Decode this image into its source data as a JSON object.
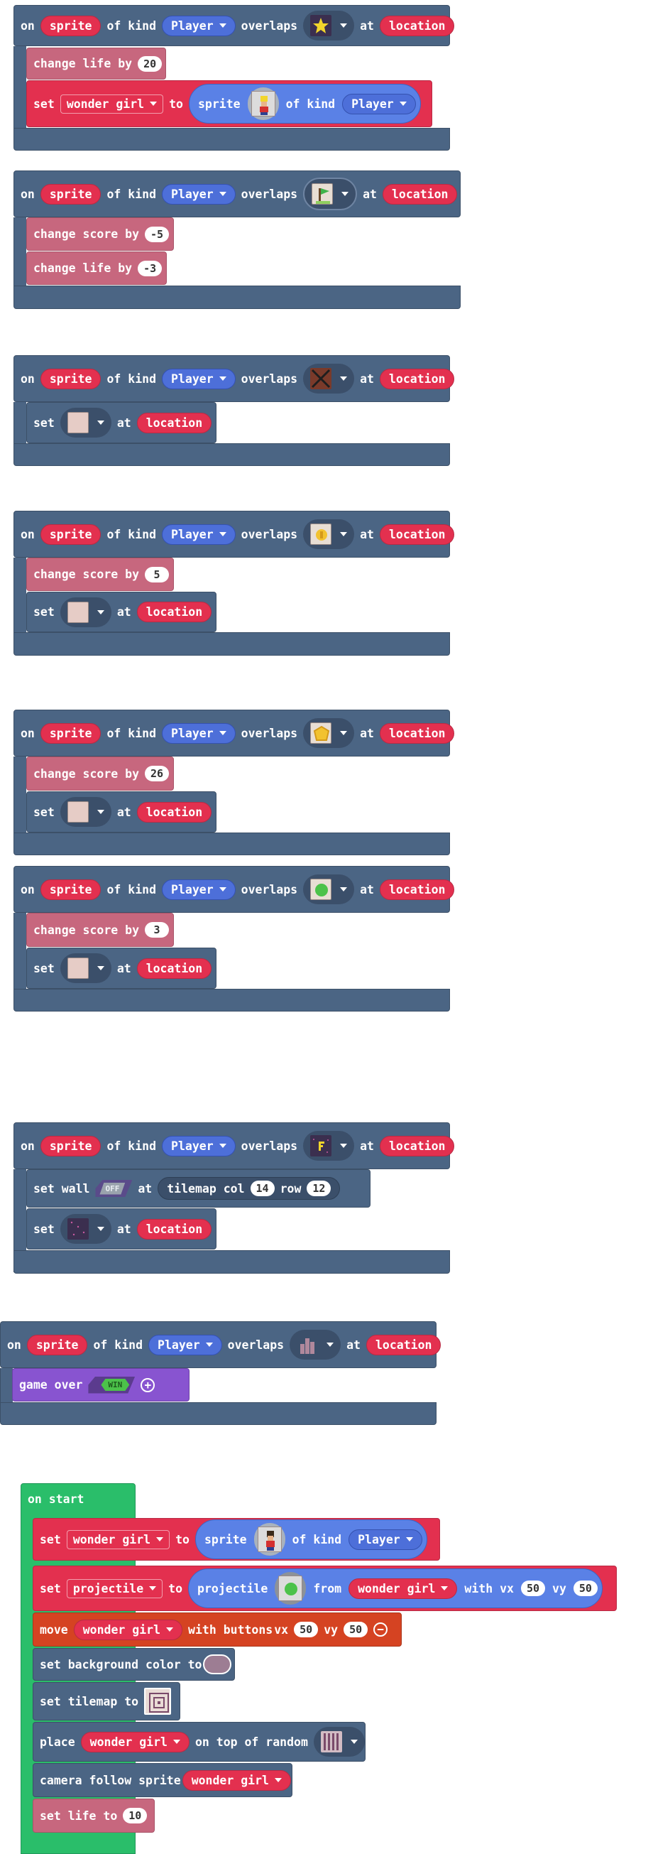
{
  "words": {
    "on": "on",
    "of_kind": "of kind",
    "overlaps": "overlaps",
    "at": "at",
    "change_life_by": "change life by",
    "change_score_by": "change score by",
    "set": "set",
    "to": "to",
    "of_kind2": "of kind",
    "set_wall": "set wall",
    "tilemap_col": "tilemap col",
    "row": "row",
    "game_over": "game over",
    "on_start": "on start",
    "from": "from",
    "with_vx": "with vx",
    "vy": "vy",
    "move": "move",
    "with_buttons": "with buttons",
    "vx": "vx",
    "set_bg_color": "set background color to",
    "set_tilemap": "set tilemap to",
    "place": "place",
    "on_top_of_random": "on top of random",
    "camera_follow": "camera follow sprite",
    "set_life_to": "set life to",
    "projectile": "projectile"
  },
  "common": {
    "sprite": "sprite",
    "kind": "Player",
    "location": "location"
  },
  "events": [
    {
      "image_icon": "yellow-star-icon",
      "statements": [
        {
          "type": "change life",
          "value": "20"
        },
        {
          "type": "set variable",
          "variable": "wonder girl",
          "sprite_kind": "Player"
        }
      ]
    },
    {
      "image_icon": "flag-icon",
      "statements": [
        {
          "type": "change score",
          "value": "-5"
        },
        {
          "type": "change life",
          "value": "-3"
        }
      ]
    },
    {
      "image_icon": "crossed-box-icon",
      "statements": [
        {
          "type": "set tile"
        }
      ]
    },
    {
      "image_icon": "coin-icon",
      "statements": [
        {
          "type": "change score",
          "value": "5"
        },
        {
          "type": "set tile"
        }
      ]
    },
    {
      "image_icon": "gem-icon",
      "statements": [
        {
          "type": "change score",
          "value": "26"
        },
        {
          "type": "set tile"
        }
      ]
    },
    {
      "image_icon": "green-blob-icon",
      "statements": [
        {
          "type": "change score",
          "value": "3"
        },
        {
          "type": "set tile"
        }
      ]
    },
    {
      "image_icon": "letter-f-tile-icon",
      "statements": [
        {
          "type": "set wall",
          "toggle": "OFF",
          "col": "14",
          "row": "12"
        },
        {
          "type": "set tile"
        }
      ]
    },
    {
      "image_icon": "tower-tile-icon",
      "statements": [
        {
          "type": "game over",
          "toggle": "WIN"
        }
      ]
    }
  ],
  "on_start": {
    "set_sprite": {
      "variable": "wonder girl",
      "kind": "Player"
    },
    "set_projectile": {
      "variable": "projectile",
      "from": "wonder girl",
      "vx": "50",
      "vy": "50"
    },
    "move": {
      "variable": "wonder girl",
      "vx": "50",
      "vy": "50"
    },
    "camera_sprite": "wonder girl",
    "life": "10"
  },
  "colors": {
    "event": "#4b6584",
    "life": "#c7677e",
    "sprite": "#e3304f",
    "kind": "#4d6fd9",
    "game": "#8854d0",
    "controller": "#d54322",
    "start": "#2abe6a"
  }
}
